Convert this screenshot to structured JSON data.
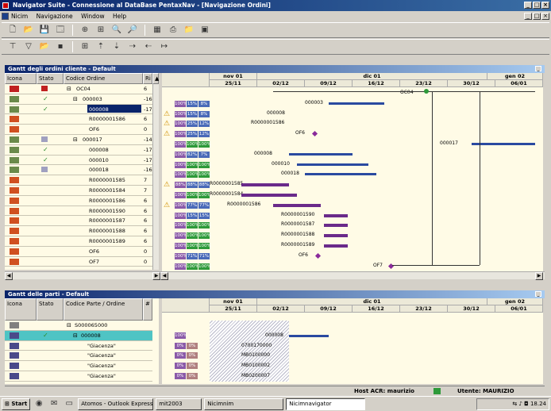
{
  "window": {
    "title": "Navigator Suite - Connessione al DataBase PentaxNav - [Navigazione Ordini]"
  },
  "menu": [
    "Nicim",
    "Navigazione",
    "Window",
    "Help"
  ],
  "top_panel": {
    "title": "Gantt degli ordini cliente - Default",
    "columns": [
      "Icona",
      "Stato",
      "Codice Ordine",
      "Ri"
    ],
    "rows": [
      {
        "code": "OC04",
        "ri": "6",
        "indent": 1
      },
      {
        "code": "000003",
        "ri": "-16",
        "indent": 2
      },
      {
        "code": "000008",
        "ri": "-17",
        "indent": 3
      },
      {
        "code": "R0000001586",
        "ri": "6",
        "indent": 3
      },
      {
        "code": "OF6",
        "ri": "0",
        "indent": 3
      },
      {
        "code": "000017",
        "ri": "-14",
        "indent": 2
      },
      {
        "code": "000008",
        "ri": "-17",
        "indent": 3
      },
      {
        "code": "000010",
        "ri": "-17",
        "indent": 3
      },
      {
        "code": "000018",
        "ri": "-16",
        "indent": 3
      },
      {
        "code": "R0000001585",
        "ri": "7",
        "indent": 3
      },
      {
        "code": "R0000001584",
        "ri": "7",
        "indent": 3
      },
      {
        "code": "R0000001586",
        "ri": "6",
        "indent": 3
      },
      {
        "code": "R0000001590",
        "ri": "6",
        "indent": 3
      },
      {
        "code": "R0000001587",
        "ri": "6",
        "indent": 3
      },
      {
        "code": "R0000001588",
        "ri": "6",
        "indent": 3
      },
      {
        "code": "R0000001589",
        "ri": "6",
        "indent": 3
      },
      {
        "code": "OF6",
        "ri": "0",
        "indent": 3
      },
      {
        "code": "OF7",
        "ri": "0",
        "indent": 3
      }
    ],
    "percent_rows": [
      [
        "",
        "",
        ""
      ],
      [
        "100%",
        "15%",
        "8%"
      ],
      [
        "100%",
        "15%",
        "8%"
      ],
      [
        "100%",
        "25%",
        "12%"
      ],
      [
        "100%",
        "25%",
        "12%"
      ],
      [
        "100%",
        "100%",
        "100%"
      ],
      [
        "100%",
        "82%",
        "7%"
      ],
      [
        "100%",
        "100%",
        "100%"
      ],
      [
        "100%",
        "100%",
        "100%"
      ],
      [
        "88%",
        "88%",
        "88%"
      ],
      [
        "100%",
        "100%",
        "100%"
      ],
      [
        "100%",
        "77%",
        "77%"
      ],
      [
        "100%",
        "15%",
        "15%"
      ],
      [
        "100%",
        "100%",
        "100%"
      ],
      [
        "100%",
        "100%",
        "100%"
      ],
      [
        "100%",
        "100%",
        "100%"
      ],
      [
        "100%",
        "71%",
        "71%"
      ],
      [
        "100%",
        "100%",
        "100%"
      ]
    ],
    "timeline_top": [
      {
        "label": "nov 01"
      },
      {
        "label": "dic 01"
      },
      {
        "label": "gen 02"
      }
    ],
    "timeline_days": [
      "25/11",
      "02/12",
      "09/12",
      "16/12",
      "23/12",
      "30/12",
      "06/01"
    ],
    "bar_labels": [
      "OC04",
      "000003",
      "000008",
      "R0000001586",
      "OF6",
      "000017",
      "000008",
      "000010",
      "000018",
      "R0000001585",
      "R0000001584",
      "R0000001586",
      "R0000001590",
      "R0000001587",
      "R0000001588",
      "R0000001589",
      "OF6",
      "OF7"
    ]
  },
  "bottom_panel": {
    "title": "Gantt delle parti - Default",
    "columns": [
      "Icona",
      "Stato",
      "Codice Parte / Ordine",
      "#"
    ],
    "rows": [
      {
        "code": "S000065000"
      },
      {
        "code": "000008"
      },
      {
        "code": "\"Giacenza\""
      },
      {
        "code": "\"Giacenza\""
      },
      {
        "code": "\"Giacenza\""
      },
      {
        "code": "\"Giacenza\""
      }
    ],
    "percent_rows": [
      [
        "",
        ""
      ],
      [
        "100%",
        ""
      ],
      [
        "0%",
        "0%"
      ],
      [
        "0%",
        "0%"
      ],
      [
        "0%",
        "0%"
      ],
      [
        "0%",
        "0%"
      ]
    ],
    "bar_labels": [
      "",
      "000008",
      "0700170000",
      "MB0100000",
      "MB0100002",
      "MB0200007"
    ],
    "timeline_top": [
      {
        "label": "nov 01"
      },
      {
        "label": "dic 01"
      },
      {
        "label": "gen 02"
      }
    ],
    "timeline_days": [
      "25/11",
      "02/12",
      "09/12",
      "16/12",
      "23/12",
      "30/12",
      "06/01"
    ]
  },
  "statusbar": {
    "host": "Host ACR: maurizio",
    "user": "Utente: MAURIZIO"
  },
  "taskbar": {
    "start": "Start",
    "items": [
      "Atomos - Outlook Express",
      "mit2003",
      "Nicimnim",
      "Nicimnavigator"
    ],
    "clock": "18.24"
  },
  "colors": {
    "title_bg": "#0a246a",
    "row_bg": "#fffbe6",
    "bar_blue": "#2a4aa0",
    "bar_purple": "#6a2a8a",
    "selected_row": "#4fc4c4",
    "pct_green": "#2e9a3a",
    "pct_blue": "#4a6ab8"
  }
}
